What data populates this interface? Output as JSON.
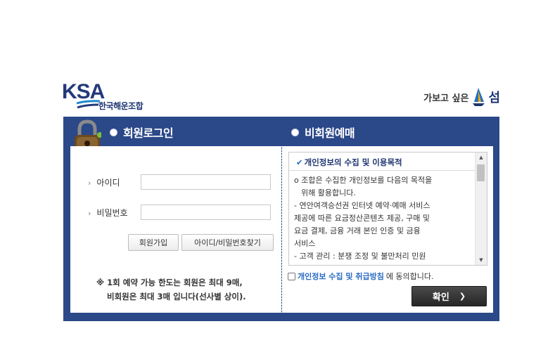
{
  "header": {
    "logo_text": "KSA",
    "logo_subtitle": "한국해운조합",
    "tagline": "가보고 싶은",
    "tagline_word": "섬"
  },
  "tabs": {
    "member": "회원로그인",
    "nonmember": "비회원예매"
  },
  "login": {
    "id_label": "아이디",
    "id_value": "",
    "password_label": "비밀번호",
    "password_value": "",
    "signup_button": "회원가입",
    "find_button": "아이디/비밀번호찾기",
    "notice_line1": "※ 1회 예약 가능 한도는 회원은 최대 9매,",
    "notice_line2": "비회원은 최대 3매 입니다(선사별 상이)."
  },
  "privacy": {
    "title": "개인정보의 수집 및 이용목적",
    "lines": [
      "o 조합은 수집한 개인정보를 다음의 목적을",
      "  위해 활용합니다.",
      "- 연안여객승선권 인터넷 예약·예매 서비스",
      "제공에 따른 요금정산콘텐츠 제공, 구매 및",
      "요금 결제, 금융 거래 본인 인증 및 금융",
      "서비스",
      "- 고객 관리 : 분쟁 조정 및 불만처리 민원"
    ],
    "agree_link": "개인정보 수집 및 취급방침",
    "agree_suffix": "에 동의합니다.",
    "confirm_label": "확인",
    "confirm_arrow": "❯"
  },
  "colors": {
    "frame": "#2b4889",
    "brand": "#1f3672",
    "link": "#2a6cc2",
    "button_dark": "#333333"
  }
}
